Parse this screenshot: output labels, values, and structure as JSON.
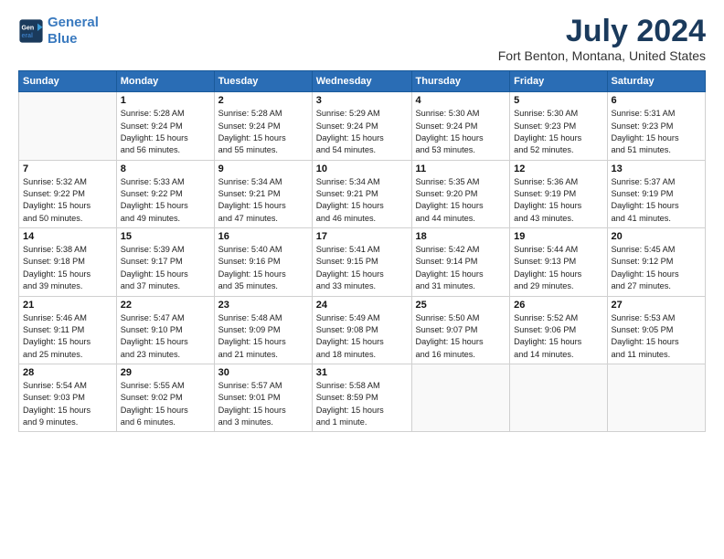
{
  "header": {
    "logo_line1": "General",
    "logo_line2": "Blue",
    "main_title": "July 2024",
    "sub_title": "Fort Benton, Montana, United States"
  },
  "weekdays": [
    "Sunday",
    "Monday",
    "Tuesday",
    "Wednesday",
    "Thursday",
    "Friday",
    "Saturday"
  ],
  "weeks": [
    [
      {
        "day": "",
        "info": ""
      },
      {
        "day": "1",
        "info": "Sunrise: 5:28 AM\nSunset: 9:24 PM\nDaylight: 15 hours\nand 56 minutes."
      },
      {
        "day": "2",
        "info": "Sunrise: 5:28 AM\nSunset: 9:24 PM\nDaylight: 15 hours\nand 55 minutes."
      },
      {
        "day": "3",
        "info": "Sunrise: 5:29 AM\nSunset: 9:24 PM\nDaylight: 15 hours\nand 54 minutes."
      },
      {
        "day": "4",
        "info": "Sunrise: 5:30 AM\nSunset: 9:24 PM\nDaylight: 15 hours\nand 53 minutes."
      },
      {
        "day": "5",
        "info": "Sunrise: 5:30 AM\nSunset: 9:23 PM\nDaylight: 15 hours\nand 52 minutes."
      },
      {
        "day": "6",
        "info": "Sunrise: 5:31 AM\nSunset: 9:23 PM\nDaylight: 15 hours\nand 51 minutes."
      }
    ],
    [
      {
        "day": "7",
        "info": "Sunrise: 5:32 AM\nSunset: 9:22 PM\nDaylight: 15 hours\nand 50 minutes."
      },
      {
        "day": "8",
        "info": "Sunrise: 5:33 AM\nSunset: 9:22 PM\nDaylight: 15 hours\nand 49 minutes."
      },
      {
        "day": "9",
        "info": "Sunrise: 5:34 AM\nSunset: 9:21 PM\nDaylight: 15 hours\nand 47 minutes."
      },
      {
        "day": "10",
        "info": "Sunrise: 5:34 AM\nSunset: 9:21 PM\nDaylight: 15 hours\nand 46 minutes."
      },
      {
        "day": "11",
        "info": "Sunrise: 5:35 AM\nSunset: 9:20 PM\nDaylight: 15 hours\nand 44 minutes."
      },
      {
        "day": "12",
        "info": "Sunrise: 5:36 AM\nSunset: 9:19 PM\nDaylight: 15 hours\nand 43 minutes."
      },
      {
        "day": "13",
        "info": "Sunrise: 5:37 AM\nSunset: 9:19 PM\nDaylight: 15 hours\nand 41 minutes."
      }
    ],
    [
      {
        "day": "14",
        "info": "Sunrise: 5:38 AM\nSunset: 9:18 PM\nDaylight: 15 hours\nand 39 minutes."
      },
      {
        "day": "15",
        "info": "Sunrise: 5:39 AM\nSunset: 9:17 PM\nDaylight: 15 hours\nand 37 minutes."
      },
      {
        "day": "16",
        "info": "Sunrise: 5:40 AM\nSunset: 9:16 PM\nDaylight: 15 hours\nand 35 minutes."
      },
      {
        "day": "17",
        "info": "Sunrise: 5:41 AM\nSunset: 9:15 PM\nDaylight: 15 hours\nand 33 minutes."
      },
      {
        "day": "18",
        "info": "Sunrise: 5:42 AM\nSunset: 9:14 PM\nDaylight: 15 hours\nand 31 minutes."
      },
      {
        "day": "19",
        "info": "Sunrise: 5:44 AM\nSunset: 9:13 PM\nDaylight: 15 hours\nand 29 minutes."
      },
      {
        "day": "20",
        "info": "Sunrise: 5:45 AM\nSunset: 9:12 PM\nDaylight: 15 hours\nand 27 minutes."
      }
    ],
    [
      {
        "day": "21",
        "info": "Sunrise: 5:46 AM\nSunset: 9:11 PM\nDaylight: 15 hours\nand 25 minutes."
      },
      {
        "day": "22",
        "info": "Sunrise: 5:47 AM\nSunset: 9:10 PM\nDaylight: 15 hours\nand 23 minutes."
      },
      {
        "day": "23",
        "info": "Sunrise: 5:48 AM\nSunset: 9:09 PM\nDaylight: 15 hours\nand 21 minutes."
      },
      {
        "day": "24",
        "info": "Sunrise: 5:49 AM\nSunset: 9:08 PM\nDaylight: 15 hours\nand 18 minutes."
      },
      {
        "day": "25",
        "info": "Sunrise: 5:50 AM\nSunset: 9:07 PM\nDaylight: 15 hours\nand 16 minutes."
      },
      {
        "day": "26",
        "info": "Sunrise: 5:52 AM\nSunset: 9:06 PM\nDaylight: 15 hours\nand 14 minutes."
      },
      {
        "day": "27",
        "info": "Sunrise: 5:53 AM\nSunset: 9:05 PM\nDaylight: 15 hours\nand 11 minutes."
      }
    ],
    [
      {
        "day": "28",
        "info": "Sunrise: 5:54 AM\nSunset: 9:03 PM\nDaylight: 15 hours\nand 9 minutes."
      },
      {
        "day": "29",
        "info": "Sunrise: 5:55 AM\nSunset: 9:02 PM\nDaylight: 15 hours\nand 6 minutes."
      },
      {
        "day": "30",
        "info": "Sunrise: 5:57 AM\nSunset: 9:01 PM\nDaylight: 15 hours\nand 3 minutes."
      },
      {
        "day": "31",
        "info": "Sunrise: 5:58 AM\nSunset: 8:59 PM\nDaylight: 15 hours\nand 1 minute."
      },
      {
        "day": "",
        "info": ""
      },
      {
        "day": "",
        "info": ""
      },
      {
        "day": "",
        "info": ""
      }
    ]
  ]
}
